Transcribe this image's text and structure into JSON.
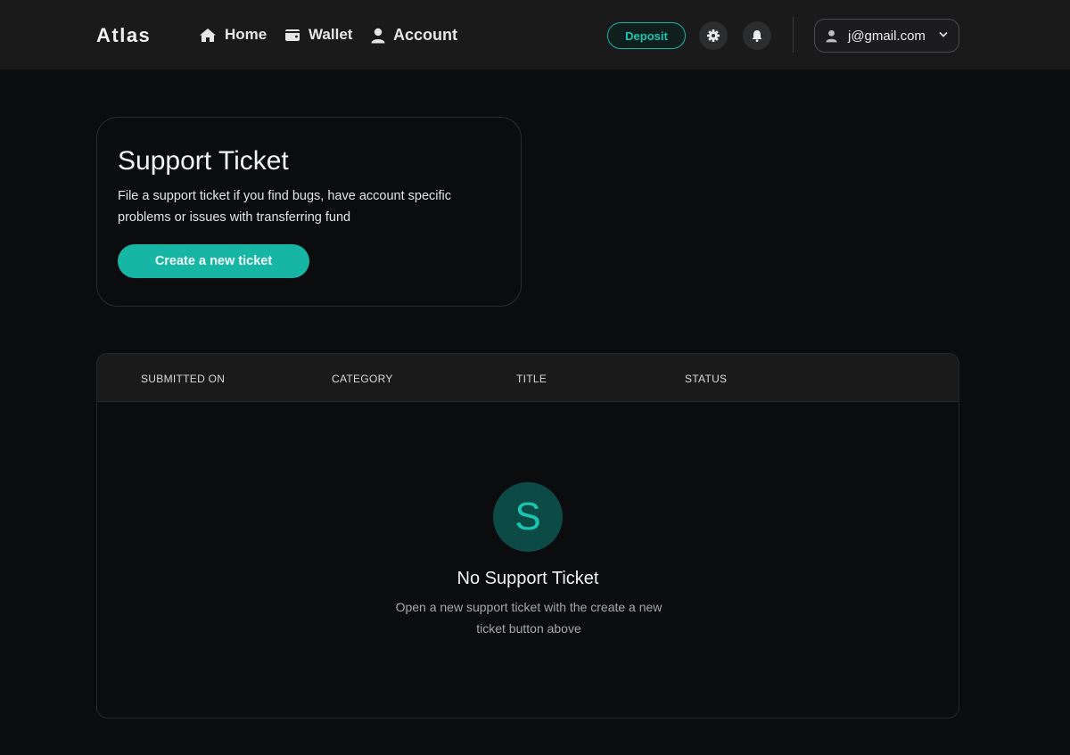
{
  "header": {
    "brand": "Atlas",
    "nav": [
      {
        "label": "Home",
        "icon": "home-icon"
      },
      {
        "label": "Wallet",
        "icon": "wallet-icon"
      },
      {
        "label": "Account",
        "icon": "user-icon"
      }
    ],
    "deposit_label": "Deposit",
    "settings_icon": "gear-icon",
    "notifications_icon": "bell-icon",
    "user_email": "j@gmail.com",
    "user_icon": "user-icon",
    "dropdown_icon": "chevron-down-icon"
  },
  "support_card": {
    "title": "Support Ticket",
    "description": "File a support ticket if you find bugs, have account specific problems or issues with transferring fund",
    "button_label": "Create a new ticket"
  },
  "table": {
    "columns": [
      "SUBMITTED ON",
      "CATEGORY",
      "TITLE",
      "STATUS"
    ],
    "rows": [],
    "empty_state": {
      "avatar_letter": "S",
      "title": "No Support Ticket",
      "description": "Open a new support ticket with the create a new ticket button above"
    }
  },
  "colors": {
    "accent": "#17b5a3",
    "background": "#0b0c0e",
    "topbar": "#1a1a1b",
    "empty_avatar_bg": "#0c4a45"
  }
}
